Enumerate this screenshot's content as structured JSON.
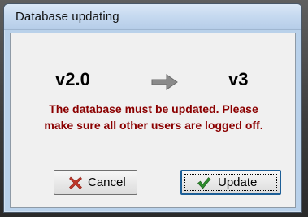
{
  "window": {
    "title": "Database updating"
  },
  "versions": {
    "from": "v2.0",
    "to": "v3",
    "arrow_icon": "right-arrow-icon"
  },
  "message": {
    "line1": "The database must be updated. Please",
    "line2": "make sure all other users are logged off."
  },
  "buttons": {
    "cancel_label": "Cancel",
    "cancel_icon": "x-icon",
    "update_label": "Update",
    "update_icon": "checkmark-icon"
  },
  "colors": {
    "message_text": "#8b0000",
    "cancel_icon": "#c0392b",
    "update_icon": "#2e8b2e",
    "arrow": "#7a7a7a"
  }
}
